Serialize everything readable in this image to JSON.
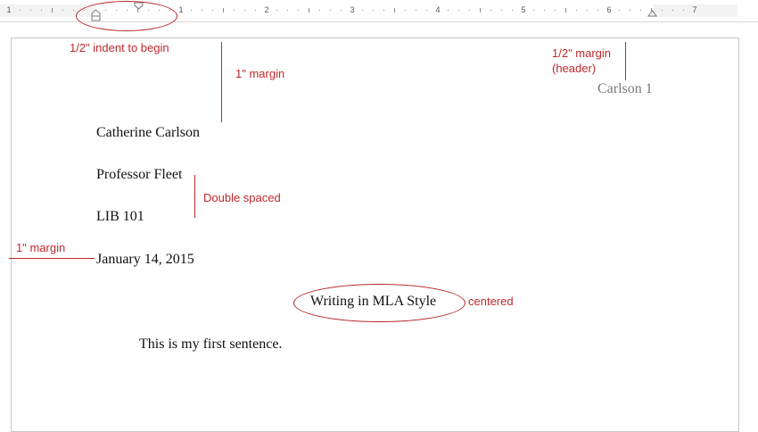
{
  "ruler": {
    "labels": [
      "1",
      "1",
      "2",
      "3",
      "4",
      "5",
      "6",
      "7"
    ]
  },
  "header": {
    "page_header": "Carlson 1"
  },
  "document": {
    "author": "Catherine Carlson",
    "professor": "Professor Fleet",
    "course": "LIB 101",
    "date": "January 14, 2015",
    "title": "Writing in MLA Style",
    "first_sentence": "This is my first sentence."
  },
  "annotations": {
    "indent": "1/2\" indent to begin",
    "top_margin": "1\" margin",
    "header_margin_line1": "1/2\" margin",
    "header_margin_line2": "(header)",
    "double_spaced": "Double spaced",
    "left_margin": "1\" margin",
    "centered": "centered"
  },
  "colors": {
    "annotation": "#c0282c",
    "header_text": "#7a7a7a"
  }
}
